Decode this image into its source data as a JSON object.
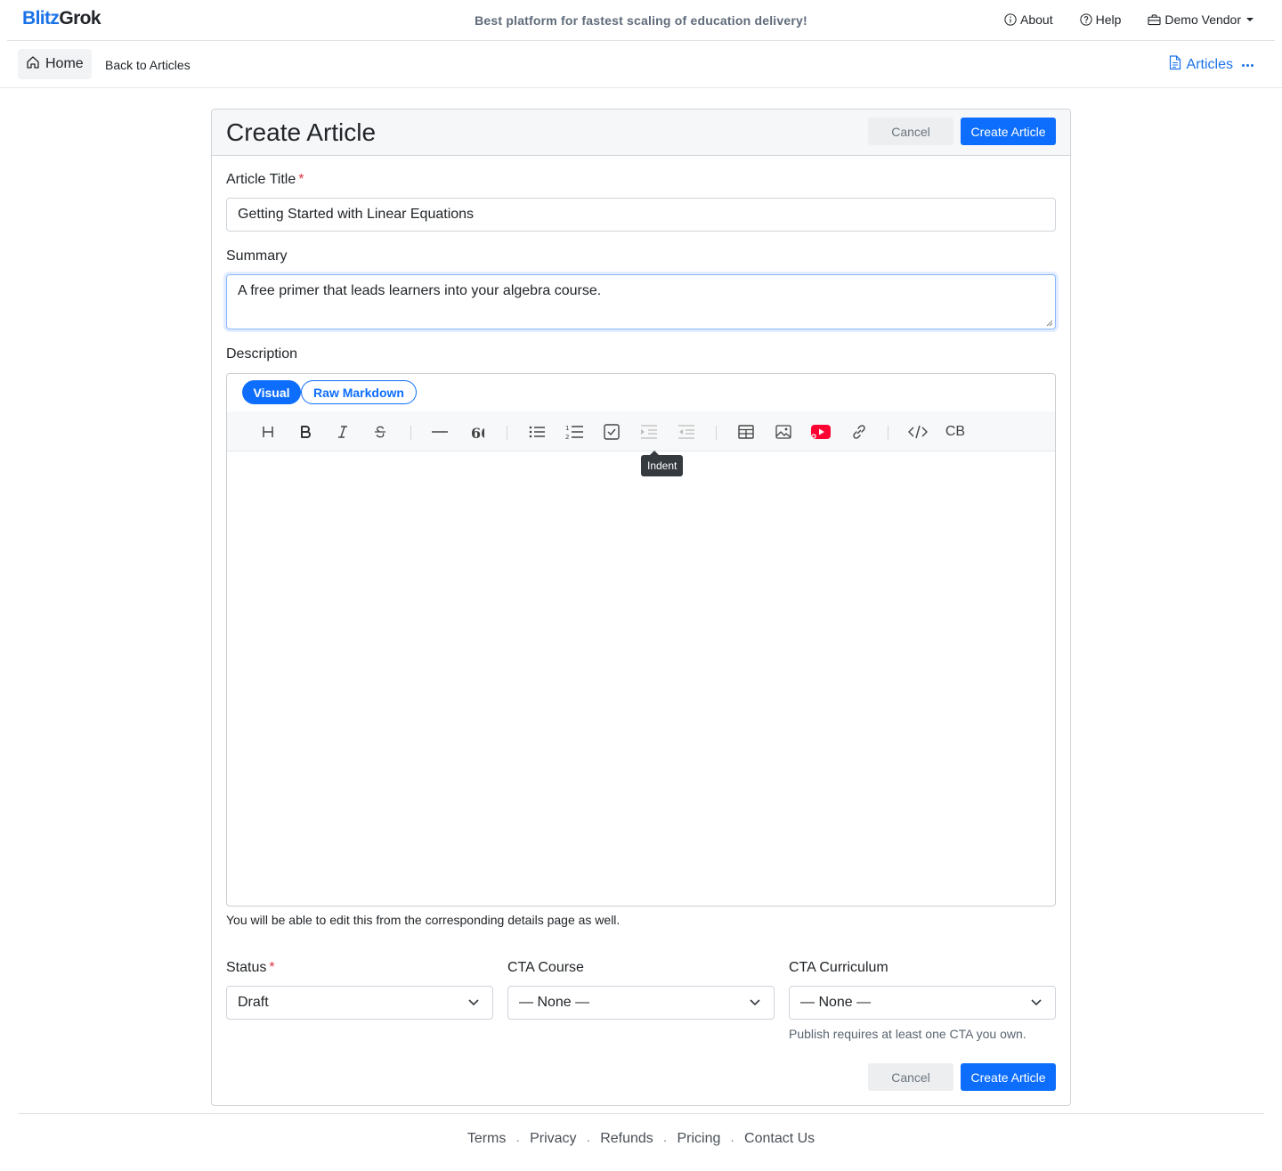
{
  "brand": {
    "part1": "Blitz",
    "part2": "Grok"
  },
  "tagline": "Best platform for fastest scaling of education delivery!",
  "topnav": {
    "about": "About",
    "help": "Help",
    "vendor": "Demo Vendor"
  },
  "subnav": {
    "home": "Home",
    "back": "Back to Articles",
    "articles": "Articles"
  },
  "form": {
    "title": "Create Article",
    "cancel_label": "Cancel",
    "submit_label": "Create Article",
    "article_title_label": "Article Title",
    "required_mark": "*",
    "article_title_value": "Getting Started with Linear Equations",
    "summary_label": "Summary",
    "summary_value": "A free primer that leads learners into your algebra course.",
    "description_label": "Description",
    "editor": {
      "tab_visual": "Visual",
      "tab_raw": "Raw Markdown",
      "codeblock_label": "CB",
      "tooltip": "Indent",
      "toolbar_icons": [
        "heading-icon",
        "bold-icon",
        "italic-icon",
        "strikethrough-icon",
        "horizontal-rule-icon",
        "quote-icon",
        "bullet-list-icon",
        "ordered-list-icon",
        "task-list-icon",
        "indent-icon",
        "outdent-icon",
        "table-icon",
        "image-icon",
        "youtube-icon",
        "link-icon",
        "code-icon",
        "codeblock-icon"
      ]
    },
    "description_help": "You will be able to edit this from the corresponding details page as well.",
    "status_label": "Status",
    "status_value": "Draft",
    "cta_course_label": "CTA Course",
    "cta_course_value": "— None —",
    "cta_curriculum_label": "CTA Curriculum",
    "cta_curriculum_value": "— None —",
    "cta_help": "Publish requires at least one CTA you own."
  },
  "footer": {
    "terms": "Terms",
    "privacy": "Privacy",
    "refunds": "Refunds",
    "pricing": "Pricing",
    "contact": "Contact Us",
    "separator": "·"
  },
  "colors": {
    "primary": "#0d6efd",
    "brand": "#1a73e8",
    "required": "#dc3545",
    "youtube": "#ff0033"
  }
}
